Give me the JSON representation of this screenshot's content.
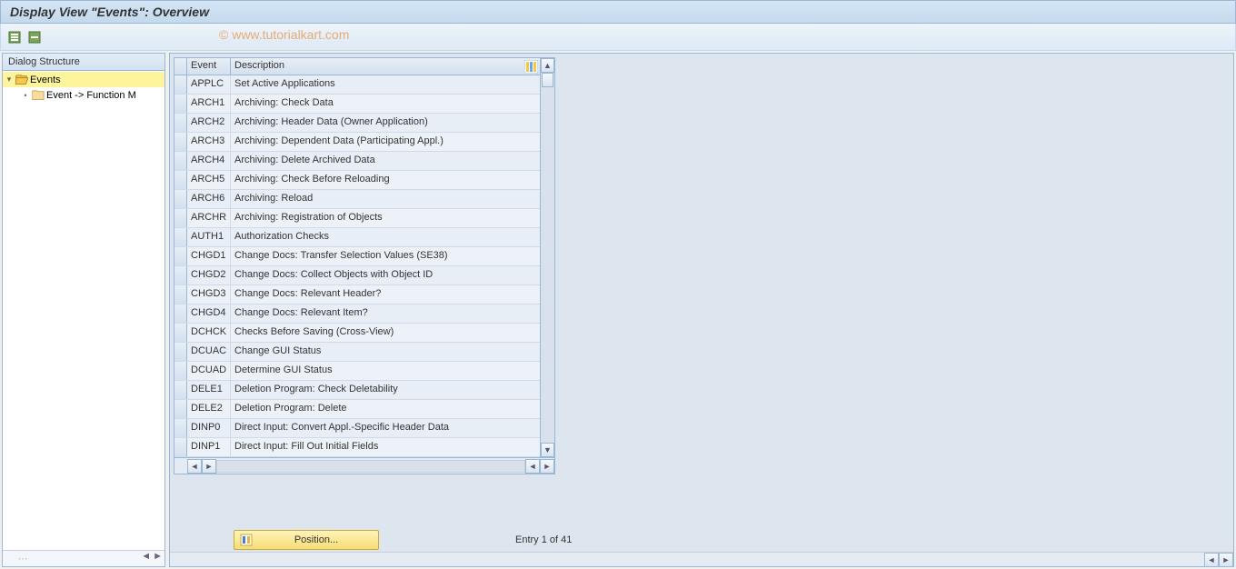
{
  "title": "Display View \"Events\": Overview",
  "watermark": "© www.tutorialkart.com",
  "tree": {
    "header": "Dialog Structure",
    "events_label": "Events",
    "child_label": "Event -> Function M"
  },
  "table": {
    "col_event": "Event",
    "col_desc": "Description",
    "rows": [
      {
        "event": "APPLC",
        "desc": "Set Active Applications"
      },
      {
        "event": "ARCH1",
        "desc": "Archiving: Check Data"
      },
      {
        "event": "ARCH2",
        "desc": "Archiving: Header Data (Owner Application)"
      },
      {
        "event": "ARCH3",
        "desc": "Archiving: Dependent Data (Participating Appl.)"
      },
      {
        "event": "ARCH4",
        "desc": "Archiving: Delete Archived Data"
      },
      {
        "event": "ARCH5",
        "desc": "Archiving: Check Before Reloading"
      },
      {
        "event": "ARCH6",
        "desc": "Archiving: Reload"
      },
      {
        "event": "ARCHR",
        "desc": "Archiving: Registration of Objects"
      },
      {
        "event": "AUTH1",
        "desc": "Authorization Checks"
      },
      {
        "event": "CHGD1",
        "desc": "Change Docs: Transfer Selection Values (SE38)"
      },
      {
        "event": "CHGD2",
        "desc": "Change Docs: Collect Objects with Object ID"
      },
      {
        "event": "CHGD3",
        "desc": "Change Docs: Relevant Header?"
      },
      {
        "event": "CHGD4",
        "desc": "Change Docs: Relevant Item?"
      },
      {
        "event": "DCHCK",
        "desc": "Checks Before Saving (Cross-View)"
      },
      {
        "event": "DCUAC",
        "desc": "Change GUI Status"
      },
      {
        "event": "DCUAD",
        "desc": "Determine GUI Status"
      },
      {
        "event": "DELE1",
        "desc": "Deletion Program: Check Deletability"
      },
      {
        "event": "DELE2",
        "desc": "Deletion Program: Delete"
      },
      {
        "event": "DINP0",
        "desc": "Direct Input: Convert Appl.-Specific Header Data"
      },
      {
        "event": "DINP1",
        "desc": "Direct Input: Fill Out Initial Fields"
      }
    ]
  },
  "footer": {
    "position_label": "Position...",
    "entry_text": "Entry 1 of 41"
  }
}
